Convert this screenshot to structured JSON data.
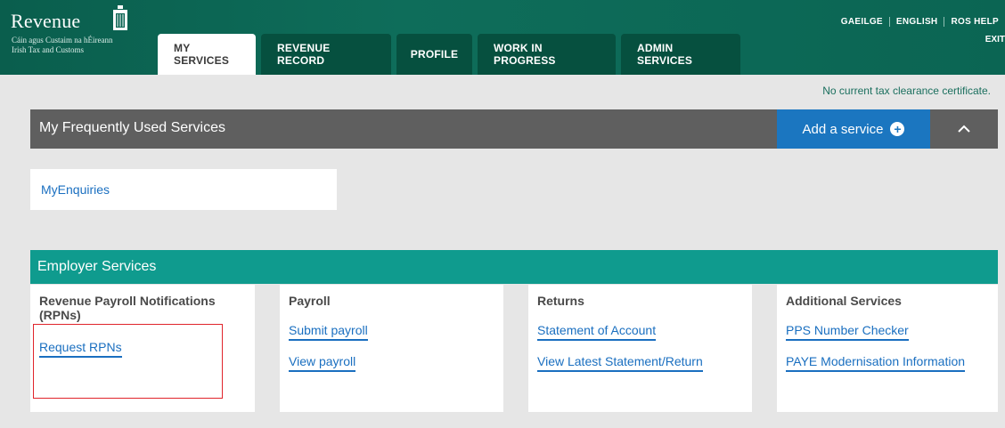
{
  "header": {
    "logo": {
      "word": "Revenue",
      "sub1": "Cáin agus Custaim na hÉireann",
      "sub2": "Irish Tax and Customs",
      "icon": "harp-icon"
    },
    "tabs": [
      {
        "label": "MY SERVICES",
        "active": true
      },
      {
        "label": "REVENUE RECORD"
      },
      {
        "label": "PROFILE"
      },
      {
        "label": "WORK IN PROGRESS"
      },
      {
        "label": "ADMIN SERVICES"
      }
    ],
    "toplinks": [
      "GAEILGE",
      "ENGLISH",
      "ROS HELP"
    ],
    "exit": "EXIT"
  },
  "main": {
    "clearance_text": "No current tax clearance certificate.",
    "frequent": {
      "title": "My Frequently Used Services",
      "add_label": "Add a service",
      "add_icon": "plus-circle-icon",
      "collapse_icon": "chevron-up-icon",
      "items": [
        "MyEnquiries"
      ]
    },
    "employer": {
      "title": "Employer Services",
      "columns": [
        {
          "heading": "Revenue Payroll Notifications (RPNs)",
          "links": [
            "Request RPNs"
          ]
        },
        {
          "heading": "Payroll",
          "links": [
            "Submit payroll",
            "View payroll"
          ]
        },
        {
          "heading": "Returns",
          "links": [
            "Statement of Account",
            "View Latest Statement/Return"
          ]
        },
        {
          "heading": "Additional Services",
          "links": [
            "PPS Number Checker",
            "PAYE Modernisation Information"
          ]
        }
      ]
    }
  },
  "colors": {
    "header_green": "#0b6553",
    "tab_dark": "#06503f",
    "employer_teal": "#0f9b8e",
    "frequent_grey": "#5f5f5f",
    "link_blue": "#1a6fc0",
    "add_blue": "#1b76c0",
    "highlight_red": "#e0242b"
  }
}
